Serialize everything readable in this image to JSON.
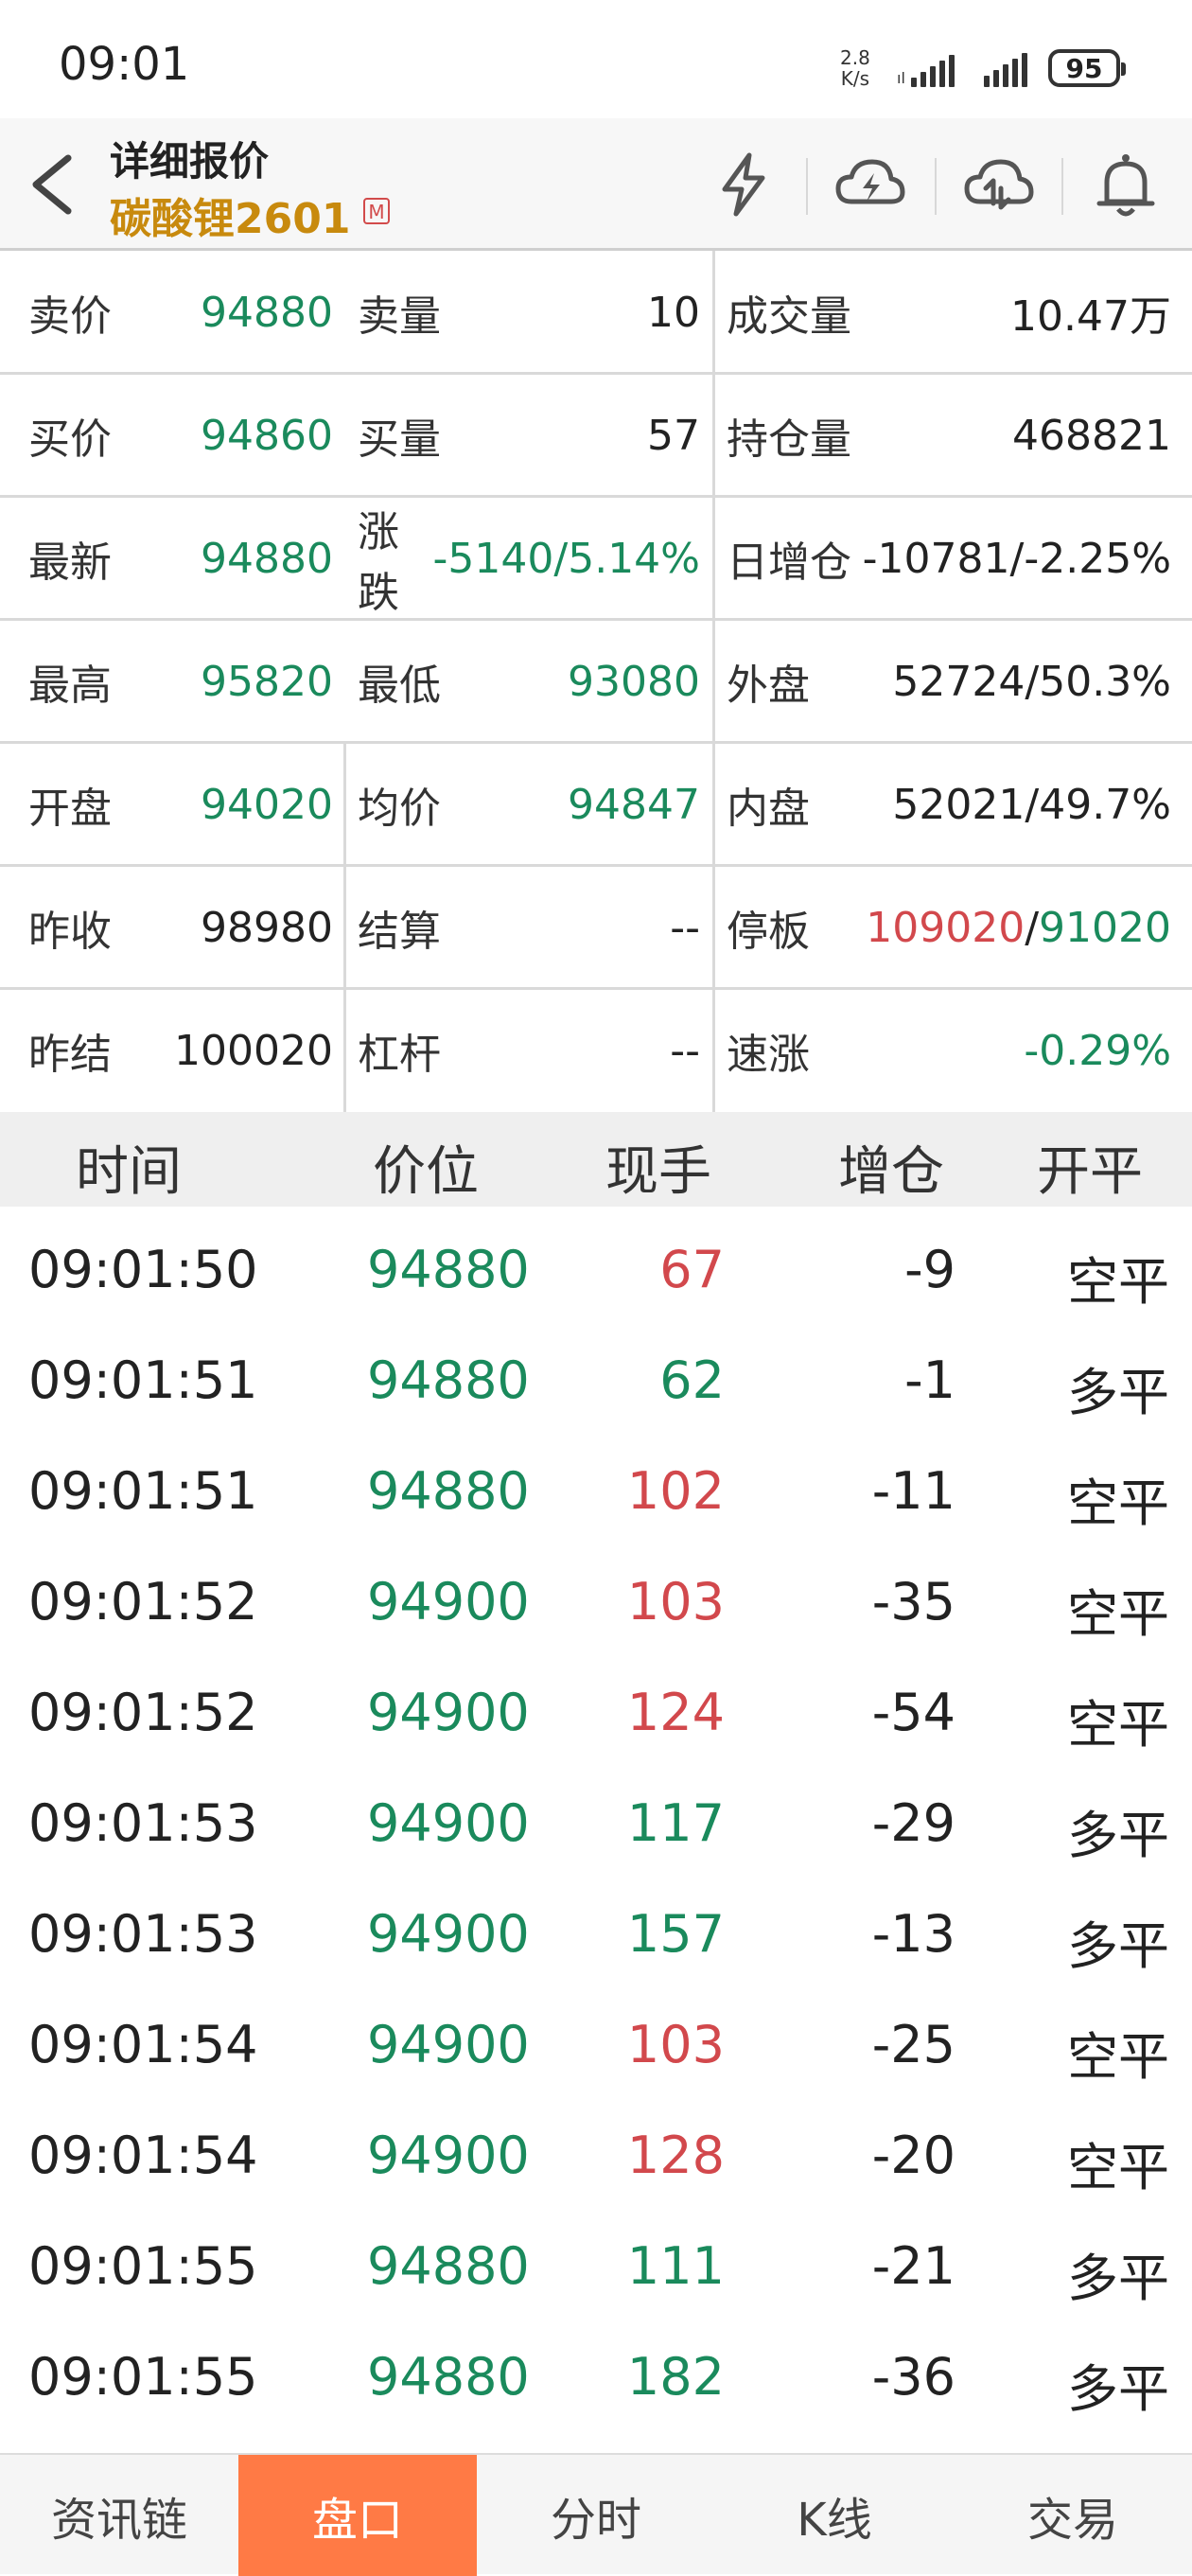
{
  "status_bar": {
    "time": "09:01",
    "net_speed_value": "2.8",
    "net_speed_unit": "K/s",
    "battery": "95"
  },
  "header": {
    "title": "详细报价",
    "instrument": "碳酸锂2601",
    "badge": "M"
  },
  "quote": {
    "row1": {
      "a_label": "卖价",
      "a_value": "94880",
      "b_label": "卖量",
      "b_value": "10",
      "c_label": "成交量",
      "c_value": "10.47万"
    },
    "row2": {
      "a_label": "买价",
      "a_value": "94860",
      "b_label": "买量",
      "b_value": "57",
      "c_label": "持仓量",
      "c_value": "468821"
    },
    "row3": {
      "a_label": "最新",
      "a_value": "94880",
      "b_label": "涨跌",
      "b_value": "-5140/5.14%",
      "c_label": "日增仓",
      "c_value": "-10781/-2.25%"
    },
    "row4": {
      "a_label": "最高",
      "a_value": "95820",
      "b_label": "最低",
      "b_value": "93080",
      "c_label": "外盘",
      "c_value": "52724/50.3%"
    },
    "row5": {
      "a_label": "开盘",
      "a_value": "94020",
      "b_label": "均价",
      "b_value": "94847",
      "c_label": "内盘",
      "c_value": "52021/49.7%"
    },
    "row6": {
      "a_label": "昨收",
      "a_value": "98980",
      "b_label": "结算",
      "b_value": "--",
      "c_label": "停板",
      "c_value_up": "109020",
      "c_value_sep": "/",
      "c_value_down": "91020"
    },
    "row7": {
      "a_label": "昨结",
      "a_value": "100020",
      "b_label": "杠杆",
      "b_value": "--",
      "c_label": "速涨",
      "c_value": "-0.29%"
    }
  },
  "trades": {
    "headers": [
      "时间",
      "价位",
      "现手",
      "增仓",
      "开平"
    ],
    "rows": [
      {
        "time": "09:01:50",
        "price": "94880",
        "volume": "67",
        "vol_color": "red",
        "oi": "-9",
        "type": "空平"
      },
      {
        "time": "09:01:51",
        "price": "94880",
        "volume": "62",
        "vol_color": "green",
        "oi": "-1",
        "type": "多平"
      },
      {
        "time": "09:01:51",
        "price": "94880",
        "volume": "102",
        "vol_color": "red",
        "oi": "-11",
        "type": "空平"
      },
      {
        "time": "09:01:52",
        "price": "94900",
        "volume": "103",
        "vol_color": "red",
        "oi": "-35",
        "type": "空平"
      },
      {
        "time": "09:01:52",
        "price": "94900",
        "volume": "124",
        "vol_color": "red",
        "oi": "-54",
        "type": "空平"
      },
      {
        "time": "09:01:53",
        "price": "94900",
        "volume": "117",
        "vol_color": "green",
        "oi": "-29",
        "type": "多平"
      },
      {
        "time": "09:01:53",
        "price": "94900",
        "volume": "157",
        "vol_color": "green",
        "oi": "-13",
        "type": "多平"
      },
      {
        "time": "09:01:54",
        "price": "94900",
        "volume": "103",
        "vol_color": "red",
        "oi": "-25",
        "type": "空平"
      },
      {
        "time": "09:01:54",
        "price": "94900",
        "volume": "128",
        "vol_color": "red",
        "oi": "-20",
        "type": "空平"
      },
      {
        "time": "09:01:55",
        "price": "94880",
        "volume": "111",
        "vol_color": "green",
        "oi": "-21",
        "type": "多平"
      },
      {
        "time": "09:01:55",
        "price": "94880",
        "volume": "182",
        "vol_color": "green",
        "oi": "-36",
        "type": "多平"
      }
    ]
  },
  "bottom_nav": {
    "tabs": [
      "资讯链",
      "盘口",
      "分时",
      "K线",
      "交易"
    ],
    "active_index": 1
  },
  "colors": {
    "up_red": "#d2484c",
    "down_green": "#1a8a5c",
    "accent_orange": "#ff7a45",
    "instrument_gold": "#c88a0e"
  }
}
